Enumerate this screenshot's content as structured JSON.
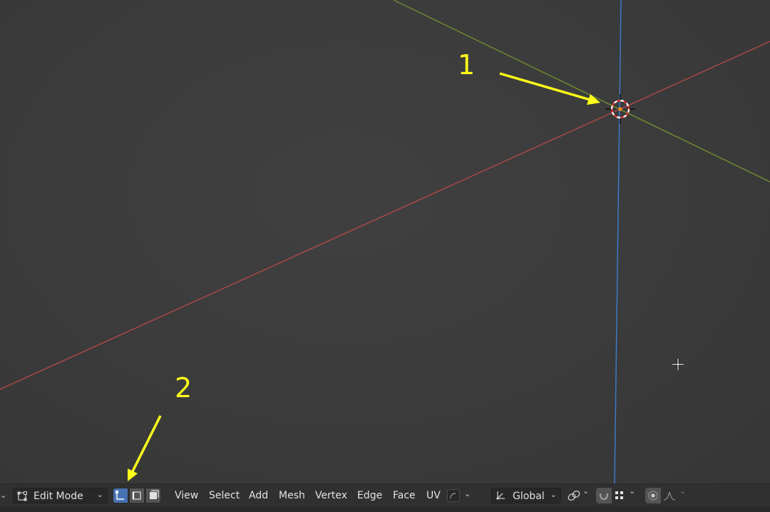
{
  "annotations": {
    "label_1": "1",
    "label_2": "2",
    "arrow_color": "#ffff1a"
  },
  "viewport": {
    "axis_colors": {
      "x": "#a84848",
      "y": "#6d8a2e",
      "z": "#3d79c7"
    },
    "background": "#3d3d3d"
  },
  "header": {
    "mode_selector": {
      "value": "Edit Mode",
      "icon": "edit-mode-icon"
    },
    "select_modes": [
      {
        "name": "vertex-select",
        "active": true
      },
      {
        "name": "edge-select",
        "active": false
      },
      {
        "name": "face-select",
        "active": false
      }
    ],
    "menus": [
      "View",
      "Select",
      "Add",
      "Mesh",
      "Vertex",
      "Edge",
      "Face",
      "UV"
    ],
    "transform_orientation": {
      "value": "Global",
      "icon": "orientation-icon"
    },
    "active_color": "#4772b3"
  }
}
